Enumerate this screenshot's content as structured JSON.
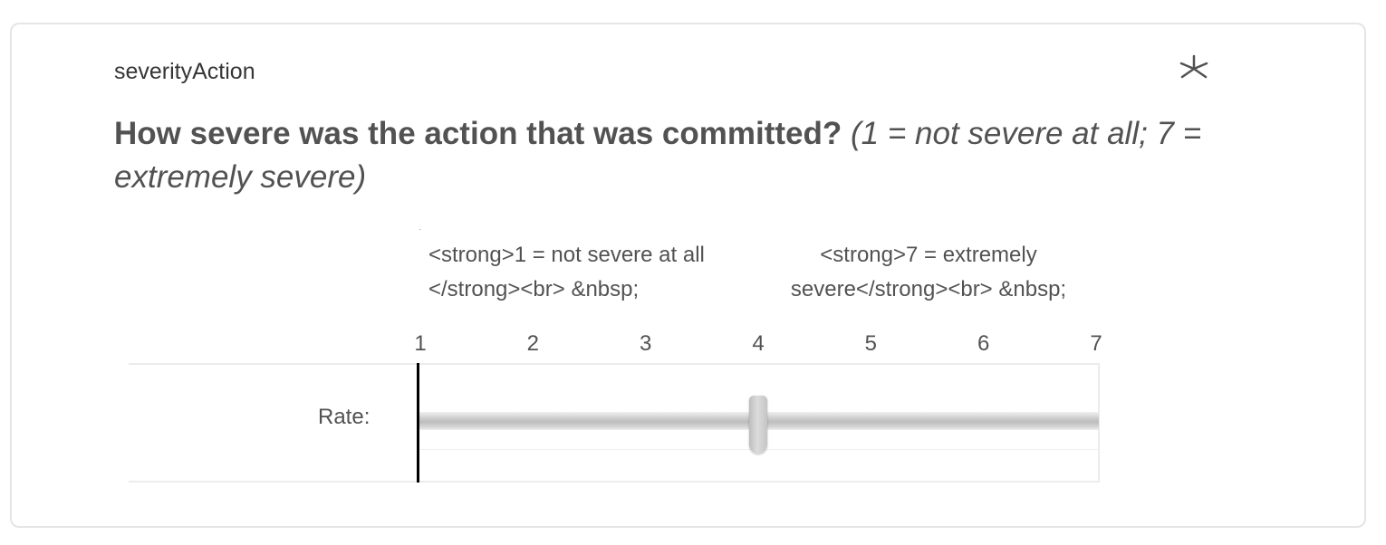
{
  "question": {
    "id": "severityAction",
    "text_bold": "How severe was the action that was committed?",
    "text_italic": "(1 = not severe at all; 7 = extremely severe)",
    "required_icon": "asterisk-icon"
  },
  "anchors": {
    "left_line1": "<strong>1 = not severe at all",
    "left_line2": "</strong><br> &nbsp;",
    "right_line1": "<strong>7 = extremely",
    "right_line2": "severe</strong><br> &nbsp;"
  },
  "scale": {
    "ticks": [
      "1",
      "2",
      "3",
      "4",
      "5",
      "6",
      "7"
    ],
    "min": 1,
    "max": 7,
    "value": 4
  },
  "row": {
    "label": "Rate:"
  },
  "colors": {
    "text": "#525252",
    "border": "#e5e5e5",
    "axis": "#000000"
  }
}
